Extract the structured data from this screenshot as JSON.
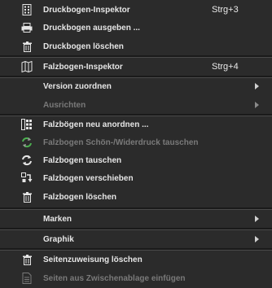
{
  "menu": {
    "items": [
      {
        "label": "Druckbogen-Inspektor",
        "shortcut": "Strg+3",
        "icon": "sheet-inspector-icon",
        "enabled": true
      },
      {
        "label": "Druckbogen ausgeben ...",
        "icon": "printer-icon",
        "enabled": true
      },
      {
        "label": "Druckbogen löschen",
        "icon": "trash-icon",
        "enabled": true
      },
      {
        "label": "Falzbogen-Inspektor",
        "shortcut": "Strg+4",
        "icon": "fold-sheet-inspector-icon",
        "enabled": true
      },
      {
        "label": "Version zuordnen",
        "submenu": true,
        "enabled": true
      },
      {
        "label": "Ausrichten",
        "submenu": true,
        "enabled": false
      },
      {
        "label": "Falzbögen neu anordnen ...",
        "icon": "rearrange-icon",
        "enabled": true
      },
      {
        "label": "Falzbogen Schön-/Widerdruck tauschen",
        "icon": "swap-sides-icon",
        "enabled": false
      },
      {
        "label": "Falzbogen tauschen",
        "icon": "swap-icon",
        "enabled": true
      },
      {
        "label": "Falzbogen verschieben",
        "icon": "move-icon",
        "enabled": true
      },
      {
        "label": "Falzbogen löschen",
        "icon": "trash-icon",
        "enabled": true
      },
      {
        "label": "Marken",
        "submenu": true,
        "enabled": true
      },
      {
        "label": "Graphik",
        "submenu": true,
        "enabled": true
      },
      {
        "label": "Seitenzuweisung löschen",
        "icon": "trash-icon",
        "enabled": true
      },
      {
        "label": "Seiten aus Zwischenablage einfügen",
        "icon": "paste-icon",
        "enabled": false
      }
    ]
  },
  "colors": {
    "background": "#2b2b2b",
    "text": "#e6e6e6",
    "disabled_text": "#7a7a7a",
    "separator": "#1a1a1a"
  }
}
